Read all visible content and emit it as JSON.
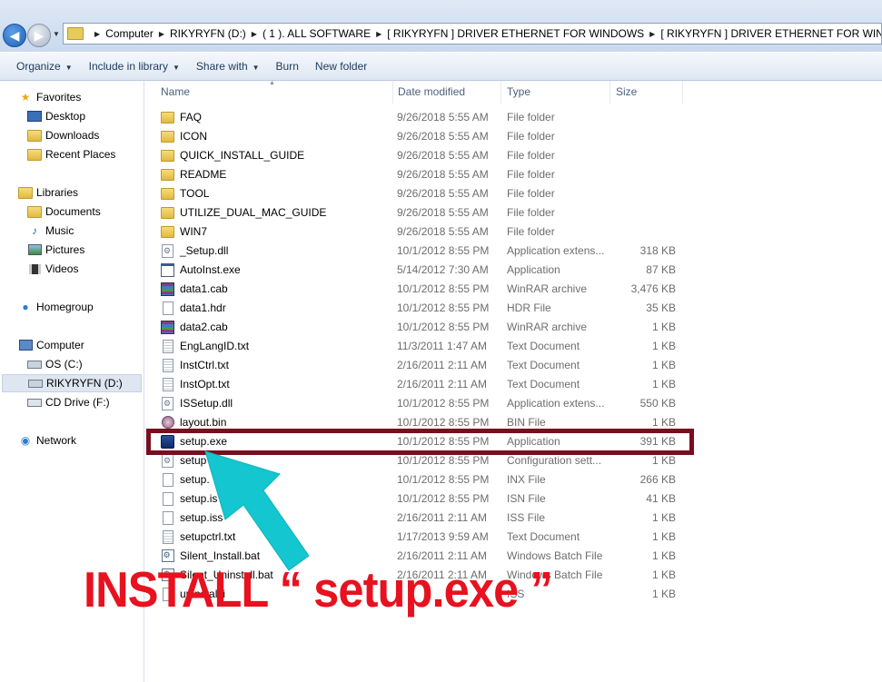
{
  "address": {
    "crumbs": [
      "Computer",
      "RIKYRYFN (D:)",
      "( 1 ). ALL SOFTWARE",
      "[ RIKYRYFN ] DRIVER ETHERNET FOR WINDOWS",
      "[ RIKYRYFN ] DRIVER ETHERNET FOR WINDOWS"
    ]
  },
  "toolbar": {
    "organize": "Organize",
    "include": "Include in library",
    "share": "Share with",
    "burn": "Burn",
    "new_folder": "New folder"
  },
  "nav": {
    "favorites": "Favorites",
    "desktop": "Desktop",
    "downloads": "Downloads",
    "recent": "Recent Places",
    "libraries": "Libraries",
    "documents": "Documents",
    "music": "Music",
    "pictures": "Pictures",
    "videos": "Videos",
    "homegroup": "Homegroup",
    "computer": "Computer",
    "os": "OS (C:)",
    "rikyryfn": "RIKYRYFN (D:)",
    "cd": "CD Drive (F:)",
    "network": "Network"
  },
  "columns": {
    "name": "Name",
    "date": "Date modified",
    "type": "Type",
    "size": "Size"
  },
  "files": [
    {
      "name": "FAQ",
      "date": "9/26/2018 5:55 AM",
      "type": "File folder",
      "size": "",
      "icon": "folder"
    },
    {
      "name": "ICON",
      "date": "9/26/2018 5:55 AM",
      "type": "File folder",
      "size": "",
      "icon": "folder"
    },
    {
      "name": "QUICK_INSTALL_GUIDE",
      "date": "9/26/2018 5:55 AM",
      "type": "File folder",
      "size": "",
      "icon": "folder"
    },
    {
      "name": "README",
      "date": "9/26/2018 5:55 AM",
      "type": "File folder",
      "size": "",
      "icon": "folder"
    },
    {
      "name": "TOOL",
      "date": "9/26/2018 5:55 AM",
      "type": "File folder",
      "size": "",
      "icon": "folder"
    },
    {
      "name": "UTILIZE_DUAL_MAC_GUIDE",
      "date": "9/26/2018 5:55 AM",
      "type": "File folder",
      "size": "",
      "icon": "folder"
    },
    {
      "name": "WIN7",
      "date": "9/26/2018 5:55 AM",
      "type": "File folder",
      "size": "",
      "icon": "folder"
    },
    {
      "name": "_Setup.dll",
      "date": "10/1/2012 8:55 PM",
      "type": "Application extens...",
      "size": "318 KB",
      "icon": "dll"
    },
    {
      "name": "AutoInst.exe",
      "date": "5/14/2012 7:30 AM",
      "type": "Application",
      "size": "87 KB",
      "icon": "app"
    },
    {
      "name": "data1.cab",
      "date": "10/1/2012 8:55 PM",
      "type": "WinRAR archive",
      "size": "3,476 KB",
      "icon": "rar"
    },
    {
      "name": "data1.hdr",
      "date": "10/1/2012 8:55 PM",
      "type": "HDR File",
      "size": "35 KB",
      "icon": "doc"
    },
    {
      "name": "data2.cab",
      "date": "10/1/2012 8:55 PM",
      "type": "WinRAR archive",
      "size": "1 KB",
      "icon": "rar"
    },
    {
      "name": "EngLangID.txt",
      "date": "11/3/2011 1:47 AM",
      "type": "Text Document",
      "size": "1 KB",
      "icon": "txt"
    },
    {
      "name": "InstCtrl.txt",
      "date": "2/16/2011 2:11 AM",
      "type": "Text Document",
      "size": "1 KB",
      "icon": "txt"
    },
    {
      "name": "InstOpt.txt",
      "date": "2/16/2011 2:11 AM",
      "type": "Text Document",
      "size": "1 KB",
      "icon": "txt"
    },
    {
      "name": "ISSetup.dll",
      "date": "10/1/2012 8:55 PM",
      "type": "Application extens...",
      "size": "550 KB",
      "icon": "dll"
    },
    {
      "name": "layout.bin",
      "date": "10/1/2012 8:55 PM",
      "type": "BIN File",
      "size": "1 KB",
      "icon": "bin"
    },
    {
      "name": "setup.exe",
      "date": "10/1/2012 8:55 PM",
      "type": "Application",
      "size": "391 KB",
      "icon": "setup"
    },
    {
      "name": "setup",
      "date": "10/1/2012 8:55 PM",
      "type": "Configuration sett...",
      "size": "1 KB",
      "icon": "dll"
    },
    {
      "name": "setup.",
      "date": "10/1/2012 8:55 PM",
      "type": "INX File",
      "size": "266 KB",
      "icon": "doc"
    },
    {
      "name": "setup.is",
      "date": "10/1/2012 8:55 PM",
      "type": "ISN File",
      "size": "41 KB",
      "icon": "doc"
    },
    {
      "name": "setup.iss",
      "date": "2/16/2011 2:11 AM",
      "type": "ISS File",
      "size": "1 KB",
      "icon": "doc"
    },
    {
      "name": "setupctrl.txt",
      "date": "1/17/2013 9:59 AM",
      "type": "Text Document",
      "size": "1 KB",
      "icon": "txt"
    },
    {
      "name": "Silent_Install.bat",
      "date": "2/16/2011 2:11 AM",
      "type": "Windows Batch File",
      "size": "1 KB",
      "icon": "bat"
    },
    {
      "name": "Silent_Uninstall.bat",
      "date": "2/16/2011 2:11 AM",
      "type": "Windows Batch File",
      "size": "1 KB",
      "icon": "bat"
    },
    {
      "name": "uninstall.i",
      "date": "",
      "type": "ISS",
      "size": "1 KB",
      "icon": "doc"
    }
  ],
  "annotation": {
    "text": "INSTALL “ setup.exe ”",
    "color": "#e8111f",
    "box_color": "#7a0d1e",
    "arrow_color": "#13c6cf"
  }
}
